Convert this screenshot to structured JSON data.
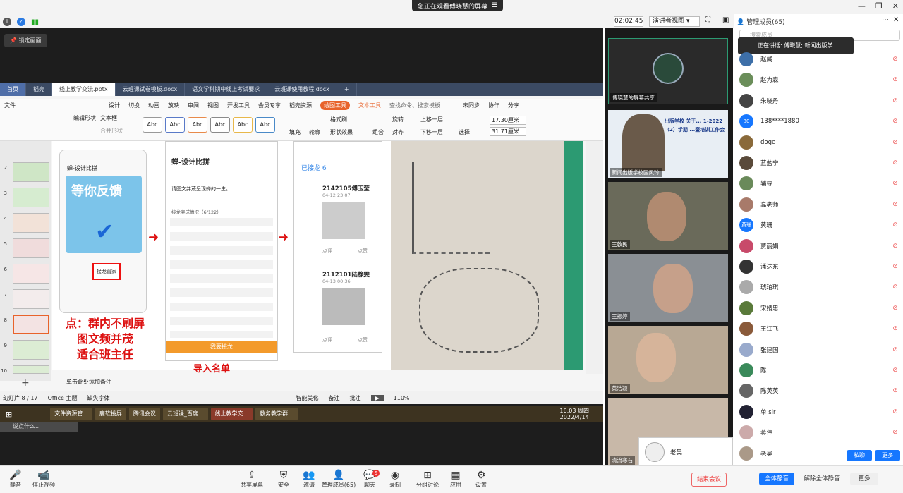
{
  "banner": {
    "text": "您正在观看傅晓慧的屏幕"
  },
  "topbar": {
    "timer": "02:02:45",
    "view_mode": "演讲者视图"
  },
  "lock_button": "锁定画面",
  "ppt": {
    "tabs": [
      "首页",
      "稻壳",
      "线上教学交流.pptx",
      "云班课试卷模板.docx",
      "语文学科期中线上考试要求",
      "云班课使用教程.docx"
    ],
    "menu": [
      "文件",
      "设计",
      "切换",
      "动画",
      "放映",
      "审阅",
      "视图",
      "开发工具",
      "会员专享",
      "稻壳资源",
      "绘图工具",
      "文本工具",
      "查找命令、搜索模板",
      "未同步",
      "协作",
      "分享"
    ],
    "ribbon": {
      "shape_edit": "编辑形状",
      "textbox": "文本框",
      "merge": "合并形状",
      "fill": "填充",
      "outline": "轮廓",
      "format_brush": "格式刷",
      "shape_effect": "形状效果",
      "rotate": "旋转",
      "align": "对齐",
      "combine": "组合",
      "up": "上移一层",
      "down": "下移一层",
      "select": "选择",
      "width": "17.30厘米",
      "height": "31.71厘米"
    },
    "abc_labels": [
      "Abc",
      "Abc",
      "Abc",
      "Abc",
      "Abc",
      "Abc"
    ],
    "thumb_numbers": [
      "2",
      "3",
      "4",
      "5",
      "6",
      "7",
      "8",
      "9",
      "10"
    ],
    "slide": {
      "phone1_title": "蝉-设计比拼",
      "phone1_banner": "等你反馈",
      "phone1_tag": "接龙管家",
      "phone2_title": "蝉-设计比拼",
      "phone2_desc": "请图文并茂呈现蝉的一生。",
      "phone2_status": "接龙完成情况（6/122）",
      "phone2_btn": "我要接龙",
      "phone2_footer": "导入名单",
      "phone3_header": "已接龙 6",
      "entry1_name": "2142105傅玉莹",
      "entry1_time": "04-12 23:07",
      "entry2_name": "2112101陆静雯",
      "entry2_time": "04-13 00:36",
      "comment": "点评",
      "like": "点赞",
      "red_text_lines": [
        "点：群内不刷屏",
        "图文频并茂",
        "适合班主任"
      ]
    },
    "notes_placeholder": "单击此处添加备注",
    "status": {
      "slide": "幻灯片 8 / 17",
      "theme": "Office 主题",
      "font": "缺失字体",
      "beautify": "智能美化",
      "notes": "备注",
      "comment": "批注",
      "zoom": "110%"
    }
  },
  "taskbar": {
    "items": [
      "文件资源管...",
      "鹿软投屏",
      "腾讯会议",
      "云班课_百度...",
      "线上教学交...",
      "教务教学群..."
    ],
    "time": "16:03 周四",
    "date": "2022/4/14"
  },
  "chat_input": "说点什么...",
  "videos": [
    {
      "label": "傅晓慧的屏幕共享"
    },
    {
      "label": "新闻出版学校国风玲",
      "slide_text": "出版学校 关于... 1-2022（2）学期 ...暨培训工作会"
    },
    {
      "label": "王敦民"
    },
    {
      "label": "王振婷"
    },
    {
      "label": "黄洁颖"
    },
    {
      "label": "清流寒石"
    }
  ],
  "members": {
    "title": "管理成员(65)",
    "search_placeholder": "搜索成员",
    "speaking": "正在讲话: 傅晓慧; 新闻出版学...",
    "list": [
      {
        "name": "赵威",
        "color": "#3d6fa8"
      },
      {
        "name": "赵为森",
        "color": "#6b8e5a"
      },
      {
        "name": "朱晓丹",
        "color": "#444"
      },
      {
        "name": "138****1880",
        "color": "#1677ff",
        "avatar_text": "80"
      },
      {
        "name": "doge",
        "color": "#8a6a3a"
      },
      {
        "name": "苴盐宁",
        "color": "#5a4a3a"
      },
      {
        "name": "辅导",
        "color": "#6a8a5a"
      },
      {
        "name": "高老师",
        "color": "#a87a6a"
      },
      {
        "name": "黄珊",
        "color": "#1677ff",
        "avatar_text": "黄珊"
      },
      {
        "name": "贾丽娟",
        "color": "#c84a6a"
      },
      {
        "name": "潘达东",
        "color": "#333"
      },
      {
        "name": "琥珀琪",
        "color": "#aaa"
      },
      {
        "name": "宋婧思",
        "color": "#5a7a3a"
      },
      {
        "name": "王江飞",
        "color": "#8a5a3a"
      },
      {
        "name": "张建国",
        "color": "#9ac"
      },
      {
        "name": "陈",
        "color": "#3a8a5a"
      },
      {
        "name": "陈英英",
        "color": "#666"
      },
      {
        "name": "单 sir",
        "color": "#223"
      },
      {
        "name": "蒋伟",
        "color": "#caa"
      },
      {
        "name": "老吴",
        "color": "#a98"
      }
    ],
    "private_chat": "私聊",
    "more": "更多"
  },
  "popup_name": "老吴",
  "bottombar": {
    "mute": "静音",
    "video": "停止视频",
    "share": "共享屏幕",
    "security": "安全",
    "invite": "邀请",
    "manage": "管理成员(65)",
    "chat": "聊天",
    "record": "录制",
    "breakout": "分组讨论",
    "apps": "应用",
    "settings": "设置",
    "end": "结束会议",
    "mute_all": "全体静音",
    "unmute_all": "解除全体静音",
    "more": "更多"
  },
  "chat_badge": "5"
}
